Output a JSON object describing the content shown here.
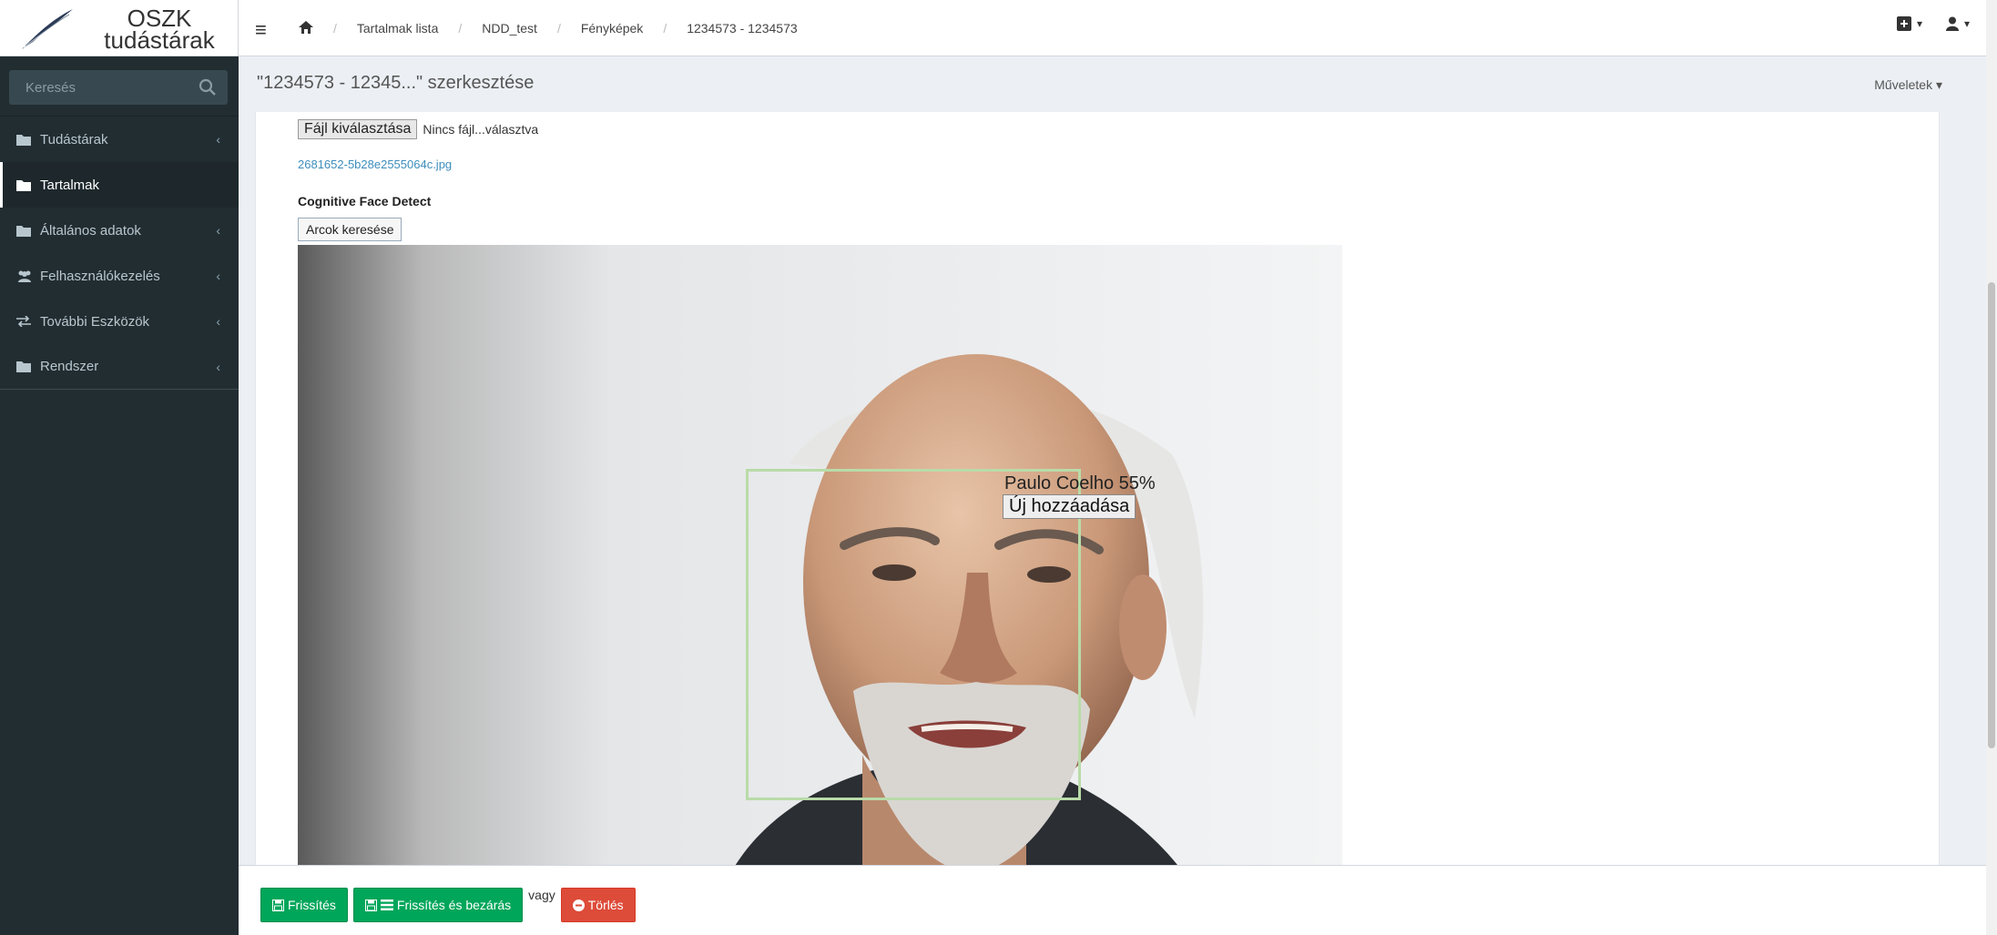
{
  "brand": {
    "line1": "OSZK",
    "line2": "tudástárak"
  },
  "search": {
    "placeholder": "Keresés"
  },
  "sidebar": {
    "items": [
      {
        "label": "Tudástárak",
        "icon": "folder-icon",
        "active": false,
        "has_children": true
      },
      {
        "label": "Tartalmak",
        "icon": "folder-icon",
        "active": true,
        "has_children": false
      },
      {
        "label": "Általános adatok",
        "icon": "folder-icon",
        "active": false,
        "has_children": true
      },
      {
        "label": "Felhasználókezelés",
        "icon": "users-icon",
        "active": false,
        "has_children": true
      },
      {
        "label": "További Eszközök",
        "icon": "exchange-icon",
        "active": false,
        "has_children": true
      },
      {
        "label": "Rendszer",
        "icon": "folder-icon",
        "active": false,
        "has_children": true
      }
    ]
  },
  "breadcrumb": {
    "items": [
      "Tartalmak lista",
      "NDD_test",
      "Fényképek",
      "1234573 - 1234573"
    ]
  },
  "page": {
    "title": "\"1234573 - 12345...\" szerkesztése",
    "actions_label": "Műveletek"
  },
  "form": {
    "file_button": "Fájl kiválasztása",
    "no_file_text": "Nincs fájl...választva",
    "file_link": "2681652-5b28e2555064c.jpg",
    "section_label": "Cognitive Face Detect",
    "face_search_button": "Arcok keresése",
    "face_result_label": "Paulo Coelho 55%",
    "face_add_button": "Új hozzáadása"
  },
  "footer": {
    "refresh": "Frissítés",
    "refresh_close": "Frissítés és bezárás",
    "or": "vagy",
    "delete": "Törlés"
  },
  "colors": {
    "sidebar_bg": "#222d32",
    "success": "#00a65a",
    "danger": "#dd4b39",
    "link": "#3c8dbc",
    "face_box": "#b9dba8"
  }
}
